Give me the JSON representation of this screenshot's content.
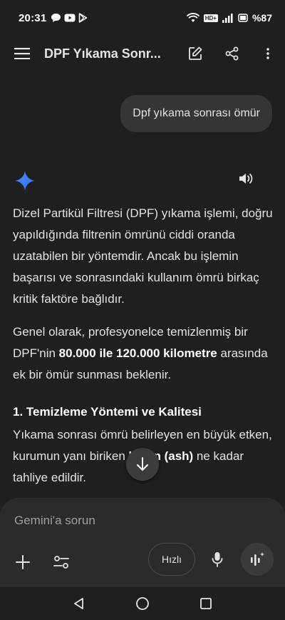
{
  "status_bar": {
    "time": "20:31",
    "battery": "%87",
    "network_badge": "HD+",
    "left_icons": [
      "chat-bubble-icon",
      "youtube-icon",
      "play-store-icon"
    ],
    "right_icons": [
      "wifi-icon",
      "signal-icon",
      "battery-icon"
    ]
  },
  "top_bar": {
    "title": "DPF Yıkama Sonr...",
    "icons": [
      "menu-icon",
      "edit-icon",
      "share-icon",
      "more-vert-icon"
    ]
  },
  "user_message": "Dpf yıkama sonrası ömür",
  "response": {
    "p1": "Dizel Partikül Filtresi (DPF) yıkama işlemi, doğru yapıldığında filtrenin ömrünü ciddi oranda uzatabilen bir yöntemdir. Ancak bu işlemin başarısı ve sonrasındaki kullanım ömrü birkaç kritik faktöre bağlıdır.",
    "p2_pre": "Genel olarak, profesyonelce temizlenmiş bir DPF'nin ",
    "p2_bold": "80.000 ile 120.000 kilometre",
    "p2_post": " arasında ek bir ömür sunması beklenir.",
    "heading1": "1. Temizleme Yöntemi ve Kalitesi",
    "p3_pre": "Yıkama sonrası ömrü belirleyen en büyük etken, kurumun yanı",
    "p3_mid": " biriken ",
    "p3_bold": "külün (ash)",
    "p3_post": " ne kadar tahliye edild",
    "p3_tail": "ir."
  },
  "input": {
    "placeholder": "Gemini'a sorun",
    "mode_label": "Hızlı"
  },
  "colors": {
    "background": "#1f1f1f",
    "bubble": "#333537",
    "panel": "#2b2b2b",
    "spark_blue": "#4a8cff"
  }
}
